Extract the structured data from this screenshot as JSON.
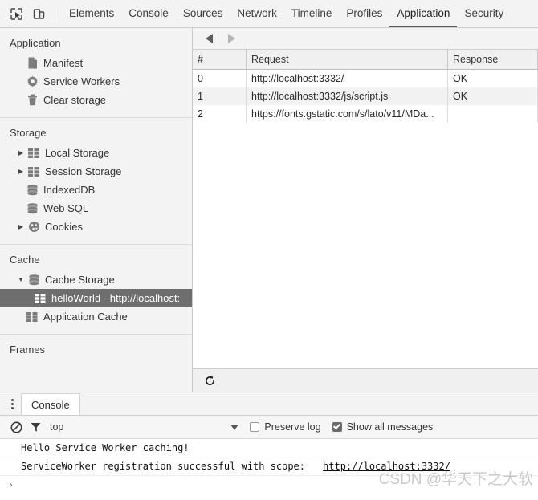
{
  "toolbar": {
    "inspect_icon": "inspect-element-icon",
    "device_icon": "toggle-device-toolbar-icon",
    "tabs": [
      {
        "label": "Elements",
        "selected": false
      },
      {
        "label": "Console",
        "selected": false
      },
      {
        "label": "Sources",
        "selected": false
      },
      {
        "label": "Network",
        "selected": false
      },
      {
        "label": "Timeline",
        "selected": false
      },
      {
        "label": "Profiles",
        "selected": false
      },
      {
        "label": "Application",
        "selected": true
      },
      {
        "label": "Security",
        "selected": false
      }
    ]
  },
  "sidebar": {
    "sections": [
      {
        "title": "Application",
        "items": [
          {
            "label": "Manifest",
            "icon": "manifest-file-icon",
            "arrow": "none",
            "indent": 2,
            "selected": false
          },
          {
            "label": "Service Workers",
            "icon": "gear-icon",
            "arrow": "none",
            "indent": 2,
            "selected": false
          },
          {
            "label": "Clear storage",
            "icon": "trash-icon",
            "arrow": "none",
            "indent": 2,
            "selected": false
          }
        ]
      },
      {
        "title": "Storage",
        "items": [
          {
            "label": "Local Storage",
            "icon": "table-grid-icon",
            "arrow": "collapsed",
            "indent": 1,
            "selected": false
          },
          {
            "label": "Session Storage",
            "icon": "table-grid-icon",
            "arrow": "collapsed",
            "indent": 1,
            "selected": false
          },
          {
            "label": "IndexedDB",
            "icon": "database-icon",
            "arrow": "none",
            "indent": 2,
            "selected": false
          },
          {
            "label": "Web SQL",
            "icon": "database-icon",
            "arrow": "none",
            "indent": 2,
            "selected": false
          },
          {
            "label": "Cookies",
            "icon": "cookie-icon",
            "arrow": "collapsed",
            "indent": 1,
            "selected": false
          }
        ]
      },
      {
        "title": "Cache",
        "items": [
          {
            "label": "Cache Storage",
            "icon": "database-icon",
            "arrow": "expanded",
            "indent": 1,
            "selected": false
          },
          {
            "label": "helloWorld - http://localhost:",
            "icon": "table-grid-icon",
            "arrow": "none",
            "indent": 3,
            "selected": true
          },
          {
            "label": "Application Cache",
            "icon": "table-grid-icon",
            "arrow": "none",
            "indent": 2,
            "selected": false
          }
        ]
      },
      {
        "title": "Frames",
        "items": []
      }
    ]
  },
  "content": {
    "nav": {
      "back_icon": "arrow-back-icon",
      "forward_icon": "arrow-forward-icon"
    },
    "table": {
      "columns": [
        "#",
        "Request",
        "Response"
      ],
      "rows": [
        {
          "num": "0",
          "request": "http://localhost:3332/",
          "response": "OK"
        },
        {
          "num": "1",
          "request": "http://localhost:3332/js/script.js",
          "response": "OK"
        },
        {
          "num": "2",
          "request": "https://fonts.gstatic.com/s/lato/v11/MDa...",
          "response": ""
        }
      ]
    },
    "footer": {
      "refresh_icon": "refresh-icon"
    }
  },
  "drawer": {
    "menu_icon": "kebab-menu-icon",
    "tab_label": "Console",
    "console_toolbar": {
      "clear_icon": "clear-console-icon",
      "filter_icon": "filter-funnel-icon",
      "context": "top",
      "caret_icon": "chevron-down-icon",
      "preserve_log_label": "Preserve log",
      "preserve_log_checked": false,
      "show_all_label": "Show all messages",
      "show_all_checked": true
    },
    "messages": [
      {
        "text": "Hello Service Worker caching!",
        "link": ""
      },
      {
        "text": "ServiceWorker registration successful with scope:",
        "link": "http://localhost:3332/"
      }
    ],
    "prompt": "›"
  },
  "watermark": "CSDN @华天下之大软"
}
